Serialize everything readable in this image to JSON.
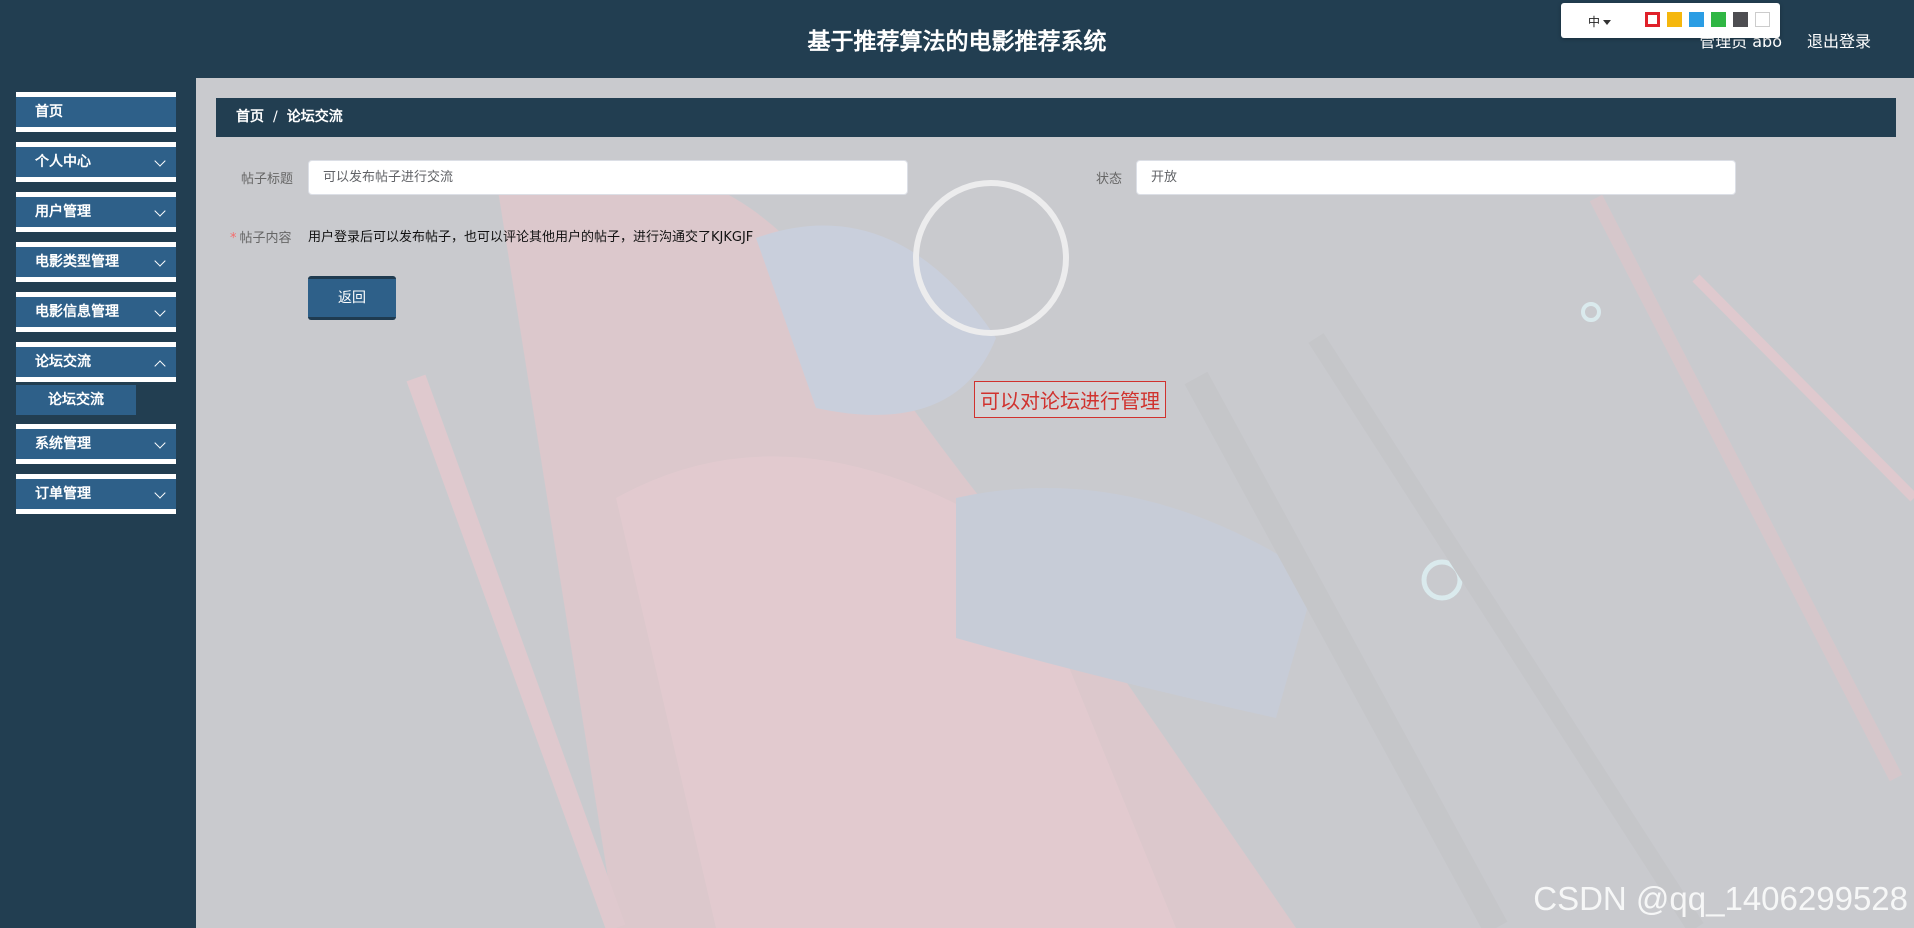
{
  "header": {
    "title": "基于推荐算法的电影推荐系统",
    "user": "管理员 abo",
    "logout": "退出登录"
  },
  "theme_bar": {
    "language": "中",
    "swatches": [
      "#e0212a",
      "#f5b70d",
      "#2a9de4",
      "#2fb644",
      "#4d4d51",
      "#ffffff"
    ]
  },
  "sidebar": {
    "items": [
      {
        "label": "首页"
      },
      {
        "label": "个人中心"
      },
      {
        "label": "用户管理"
      },
      {
        "label": "电影类型管理"
      },
      {
        "label": "电影信息管理"
      },
      {
        "label": "论坛交流"
      },
      {
        "label": "系统管理"
      },
      {
        "label": "订单管理"
      }
    ],
    "submenu": {
      "label": "论坛交流"
    }
  },
  "breadcrumb": {
    "home": "首页",
    "separator": "/",
    "current": "论坛交流"
  },
  "form": {
    "title_label": "帖子标题",
    "title_value": "可以发布帖子进行交流",
    "status_label": "状态",
    "status_value": "开放",
    "required_mark": "*",
    "content_label": "帖子内容",
    "content_value": "用户登录后可以发布帖子，也可以评论其他用户的帖子，进行沟通交了KJKGJF",
    "back_button": "返回"
  },
  "annotation": "可以对论坛进行管理",
  "watermark": "CSDN @qq_1406299528"
}
